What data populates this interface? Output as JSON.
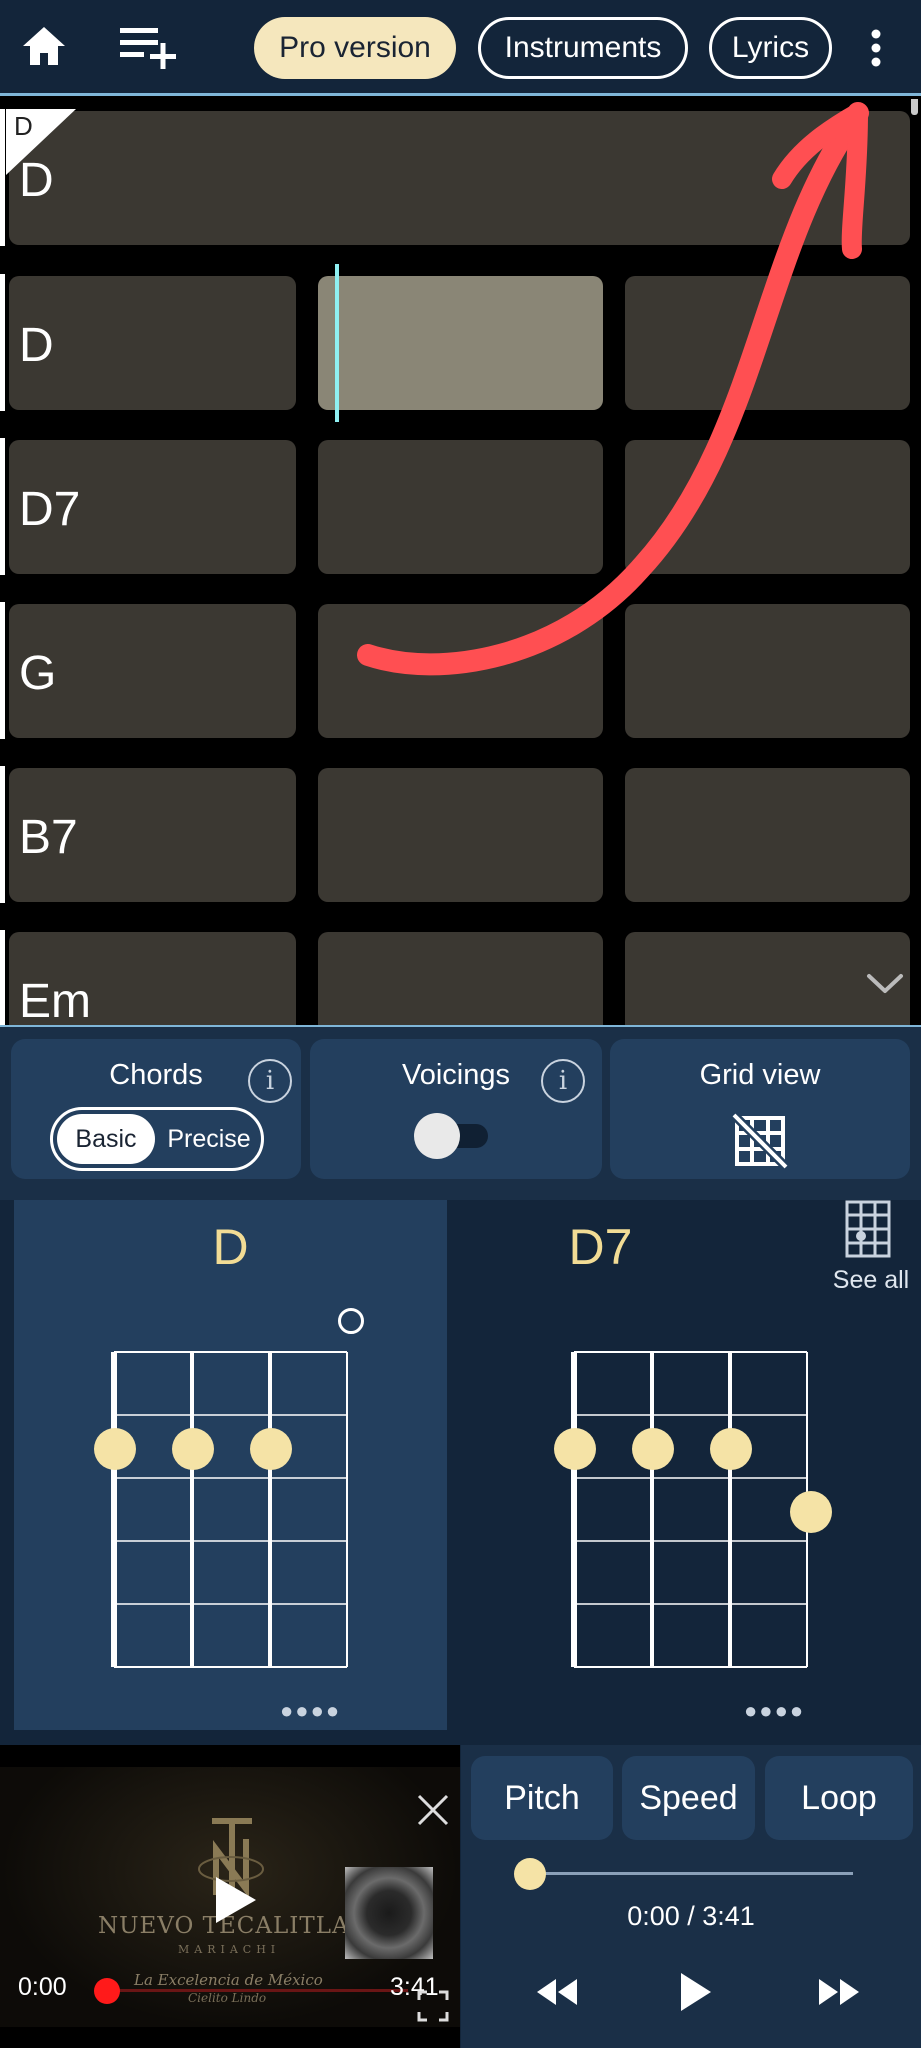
{
  "topbar": {
    "home_icon": "home-icon",
    "add_playlist_icon": "playlist-add-icon",
    "pro_label": "Pro version",
    "instruments_label": "Instruments",
    "lyrics_label": "Lyrics",
    "more_icon": "more-vertical-icon"
  },
  "grid": {
    "section_marker": "D",
    "rows": [
      {
        "chord": "D",
        "full": true
      },
      {
        "chord": "D"
      },
      {
        "chord": "D7"
      },
      {
        "chord": "G"
      },
      {
        "chord": "B7"
      },
      {
        "chord": "Em"
      }
    ],
    "scroll_down_icon": "chevron-down-icon",
    "annotation_color": "#ff4f52"
  },
  "controls": {
    "chords_title": "Chords",
    "chords_basic": "Basic",
    "chords_precise": "Precise",
    "voicings_title": "Voicings",
    "voicings_on": false,
    "grid_view_title": "Grid view"
  },
  "diagrams": {
    "chords": [
      {
        "name": "D",
        "selected": true
      },
      {
        "name": "D7",
        "selected": false
      }
    ],
    "see_all_label": "See all"
  },
  "video": {
    "logo_text": "NUEVO TECALITLAN",
    "sub_text": "MARIACHI",
    "tagline": "La Excelencia de México",
    "song_text": "Cielito Lindo",
    "time_current": "0:00",
    "time_total": "3:41"
  },
  "player": {
    "pitch_label": "Pitch",
    "speed_label": "Speed",
    "loop_label": "Loop",
    "time_display": "0:00 / 3:41",
    "progress": 0
  },
  "colors": {
    "accent": "#f5e7bd",
    "chord_name": "#f2dc95",
    "dot": "#f5e3a6",
    "cursor": "#8ff0f2"
  }
}
